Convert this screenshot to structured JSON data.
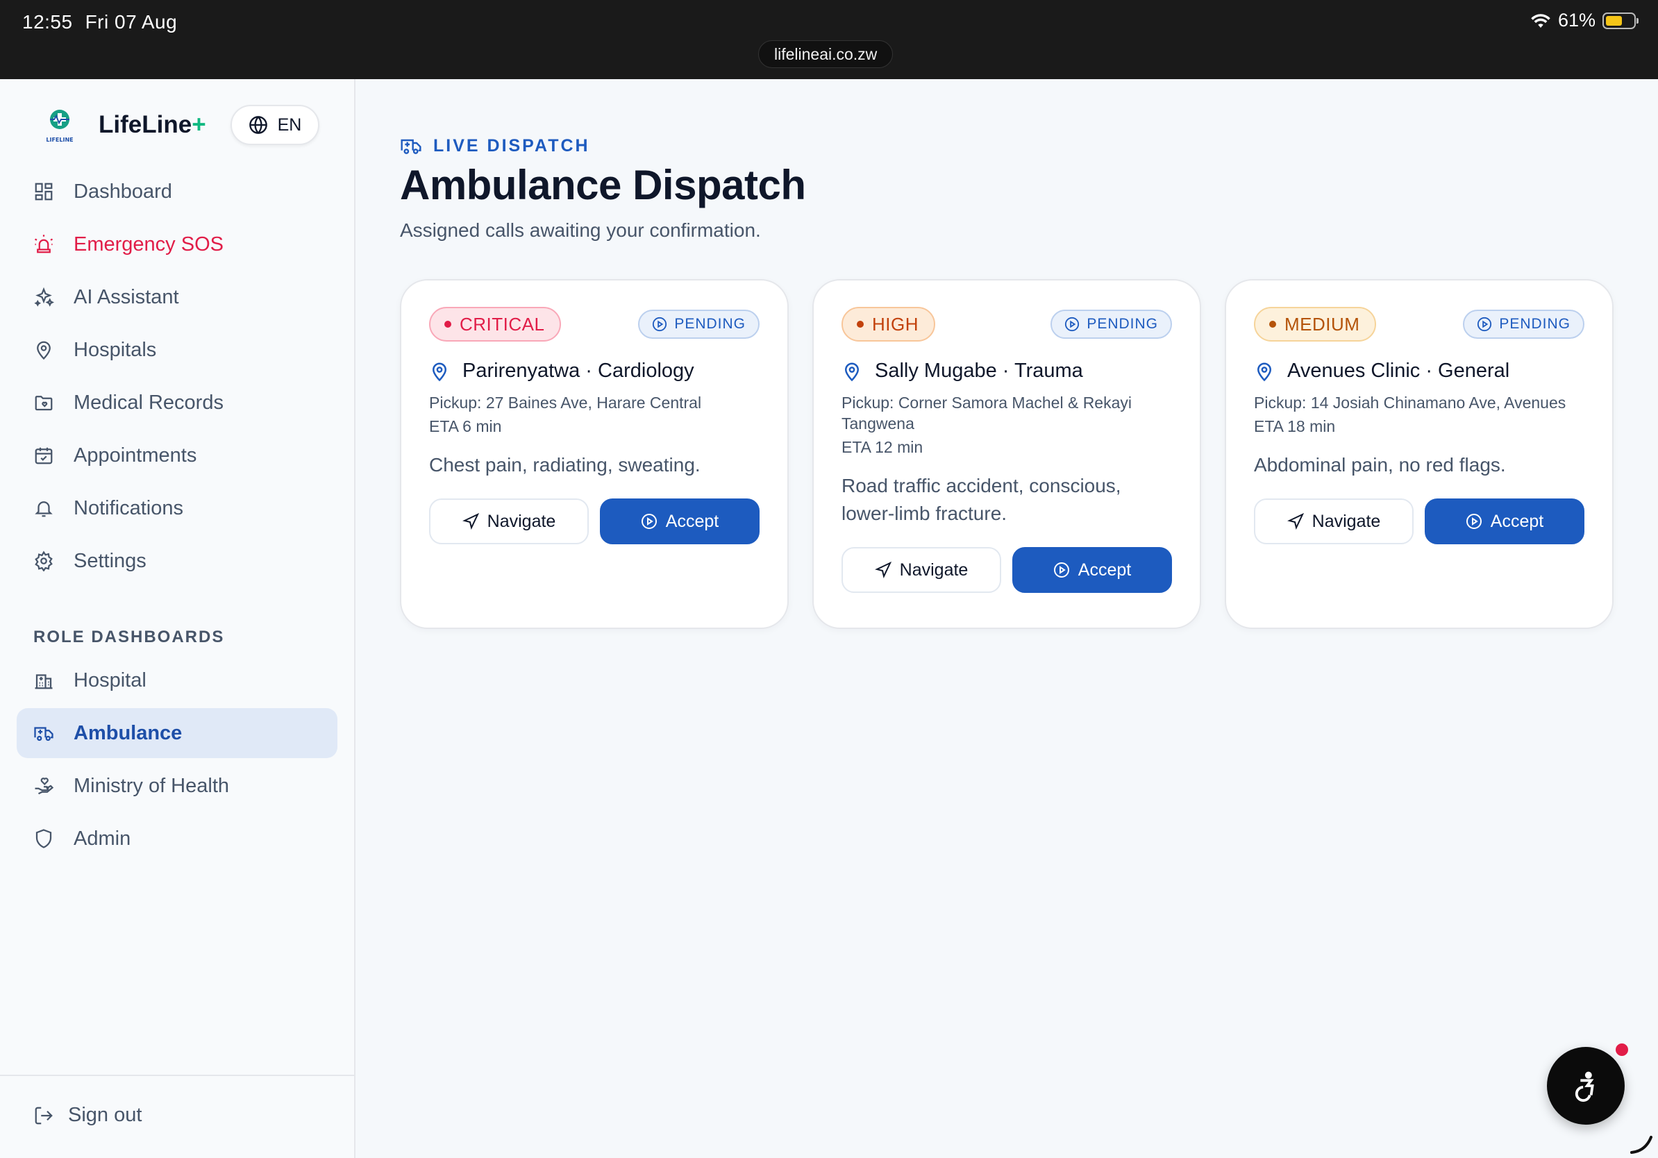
{
  "status_bar": {
    "time": "12:55",
    "date": "Fri 07 Aug",
    "url": "lifelineai.co.zw",
    "battery": "61%",
    "battery_level": 0.61
  },
  "brand": {
    "name": "LifeLine",
    "plus": "+",
    "logo_text": "LIFELINE",
    "language": "EN"
  },
  "nav": {
    "items": [
      {
        "label": "Dashboard",
        "icon": "layout-grid-icon"
      },
      {
        "label": "Emergency SOS",
        "icon": "siren-icon"
      },
      {
        "label": "AI Assistant",
        "icon": "sparkles-icon"
      },
      {
        "label": "Hospitals",
        "icon": "map-pin-icon"
      },
      {
        "label": "Medical Records",
        "icon": "folder-heart-icon"
      },
      {
        "label": "Appointments",
        "icon": "calendar-check-icon"
      },
      {
        "label": "Notifications",
        "icon": "bell-icon"
      },
      {
        "label": "Settings",
        "icon": "gear-icon"
      }
    ],
    "role_section_label": "ROLE DASHBOARDS",
    "role_items": [
      {
        "label": "Hospital",
        "icon": "hospital-icon"
      },
      {
        "label": "Ambulance",
        "icon": "ambulance-icon",
        "active": true
      },
      {
        "label": "Ministry of Health",
        "icon": "hand-heart-icon"
      },
      {
        "label": "Admin",
        "icon": "shield-icon"
      }
    ],
    "sign_out": "Sign out"
  },
  "header": {
    "eyebrow": "LIVE DISPATCH",
    "title": "Ambulance Dispatch",
    "subtitle": "Assigned calls awaiting your confirmation."
  },
  "calls": [
    {
      "severity": "CRITICAL",
      "status": "PENDING",
      "destination": "Parirenyatwa · Cardiology",
      "pickup": "Pickup: 27 Baines Ave, Harare Central",
      "eta": "ETA 6 min",
      "description": "Chest pain, radiating, sweating.",
      "navigate_label": "Navigate",
      "accept_label": "Accept"
    },
    {
      "severity": "HIGH",
      "status": "PENDING",
      "destination": "Sally Mugabe · Trauma",
      "pickup": "Pickup: Corner Samora Machel & Rekayi Tangwena",
      "eta": "ETA 12 min",
      "description": "Road traffic accident, conscious, lower-limb fracture.",
      "navigate_label": "Navigate",
      "accept_label": "Accept"
    },
    {
      "severity": "MEDIUM",
      "status": "PENDING",
      "destination": "Avenues Clinic · General",
      "pickup": "Pickup: 14 Josiah Chinamano Ave, Avenues",
      "eta": "ETA 18 min",
      "description": "Abdominal pain, no red flags.",
      "navigate_label": "Navigate",
      "accept_label": "Accept"
    }
  ],
  "colors": {
    "primary": "#1d5bbf",
    "critical": "#e11d48",
    "high": "#c2410c",
    "medium": "#b45309",
    "brand_plus": "#10b981"
  },
  "floating": {
    "icon": "accessibility-icon"
  }
}
